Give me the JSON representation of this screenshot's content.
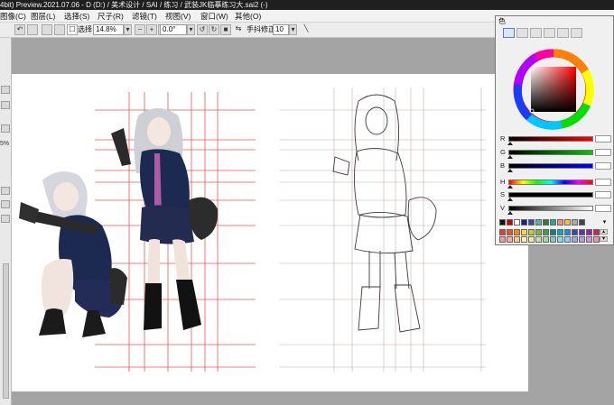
{
  "window": {
    "title": "4bit) Preview.2021.07.06 - D (D:) / 美术设计 / SAI / 练习 / 武装JK临摹练习大.sai2 (-)"
  },
  "menu": {
    "items": [
      "图像(C)",
      "图层(L)",
      "选择(S)",
      "尺子(R)",
      "滤镜(T)",
      "视图(V)",
      "窗口(W)",
      "其他(O)"
    ]
  },
  "toolbar": {
    "select_label": "选择",
    "zoom_value": "14.8%",
    "rotation_value": "0.0°",
    "stabilizer_label": "手抖修正",
    "stabilizer_value": "10"
  },
  "left_strip": {
    "zoom_fragment": "5%"
  },
  "color_panel": {
    "title": "色",
    "sliders": [
      {
        "label": "R",
        "value": 0,
        "color_from": "#000000",
        "color_to": "#ff0000"
      },
      {
        "label": "G",
        "value": 0,
        "color_from": "#000000",
        "color_to": "#00cc00"
      },
      {
        "label": "B",
        "value": 0,
        "color_from": "#000000",
        "color_to": "#0000ff"
      },
      {
        "label": "H",
        "value": 0,
        "color_from": "hue",
        "color_to": "hue"
      },
      {
        "label": "S",
        "value": 0,
        "color_from": "#000000",
        "color_to": "#000000"
      },
      {
        "label": "V",
        "value": 0,
        "color_from": "#000000",
        "color_to": "#ffffff"
      }
    ],
    "swatch_row1": [
      "#111111",
      "#cc0000",
      "#ffffff",
      "#1a237e",
      "#3949ab",
      "#4db6ac",
      "#2e7d32",
      "#26a69a",
      "#ff8a65",
      "#ffb74d",
      "#aaaaaa",
      "#444444"
    ],
    "swatch_row2": [
      "#e53935",
      "#f4511e",
      "#fb8c00",
      "#fdd835",
      "#c0ca33",
      "#7cb342",
      "#43a047",
      "#00897b",
      "#00acc1",
      "#1e88e5",
      "#3949ab",
      "#5e35b1",
      "#8e24aa",
      "#d81b60"
    ],
    "swatch_row3": [
      "#ef9a9a",
      "#ffab91",
      "#ffcc80",
      "#fff59d",
      "#e6ee9c",
      "#c5e1a5",
      "#a5d6a7",
      "#80cbc4",
      "#80deea",
      "#90caf9",
      "#9fa8da",
      "#b39ddb",
      "#ce93d8",
      "#f48fb1"
    ]
  },
  "colors": {
    "accent_guide_lines": "#e53935",
    "uniform_navy": "#1c2a52",
    "titlebar": "#1f1f1f"
  }
}
